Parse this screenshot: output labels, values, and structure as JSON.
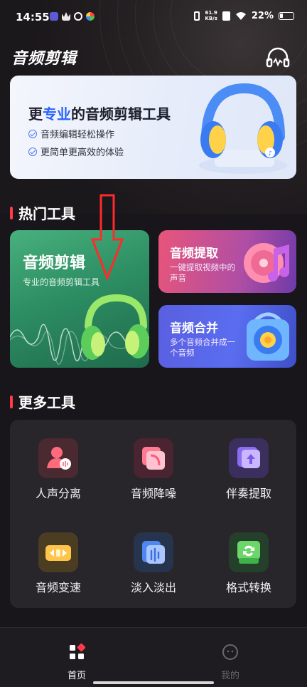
{
  "status_bar": {
    "time": "14:55",
    "net_speed_value": "61.9",
    "net_speed_unit": "KB/s",
    "battery": "22%"
  },
  "header": {
    "title": "音频剪辑",
    "icon": "headphone-icon"
  },
  "banner": {
    "title_prefix": "更",
    "title_highlight": "专业",
    "title_suffix": "的音频剪辑工具",
    "line1": "音频编辑轻松操作",
    "line2": "更简单更高效的体验",
    "accent_color": "#2a63ff"
  },
  "hot_tools": {
    "section_title": "热门工具",
    "accent_color": "#ff3a4a",
    "edit": {
      "title": "音频剪辑",
      "subtitle": "专业的音频剪辑工具"
    },
    "extract": {
      "title": "音频提取",
      "subtitle": "一键提取视频中的声音"
    },
    "merge": {
      "title": "音频合并",
      "subtitle": "多个音频合并成一个音频"
    }
  },
  "more_tools": {
    "section_title": "更多工具",
    "items": [
      {
        "label": "人声分离",
        "icon": "vocal-separate-icon"
      },
      {
        "label": "音频降噪",
        "icon": "noise-reduce-icon"
      },
      {
        "label": "伴奏提取",
        "icon": "accompaniment-extract-icon"
      },
      {
        "label": "音频变速",
        "icon": "speed-change-icon"
      },
      {
        "label": "淡入淡出",
        "icon": "fade-icon"
      },
      {
        "label": "格式转换",
        "icon": "format-convert-icon"
      }
    ]
  },
  "bottom_nav": {
    "home": "首页",
    "mine": "我的"
  }
}
